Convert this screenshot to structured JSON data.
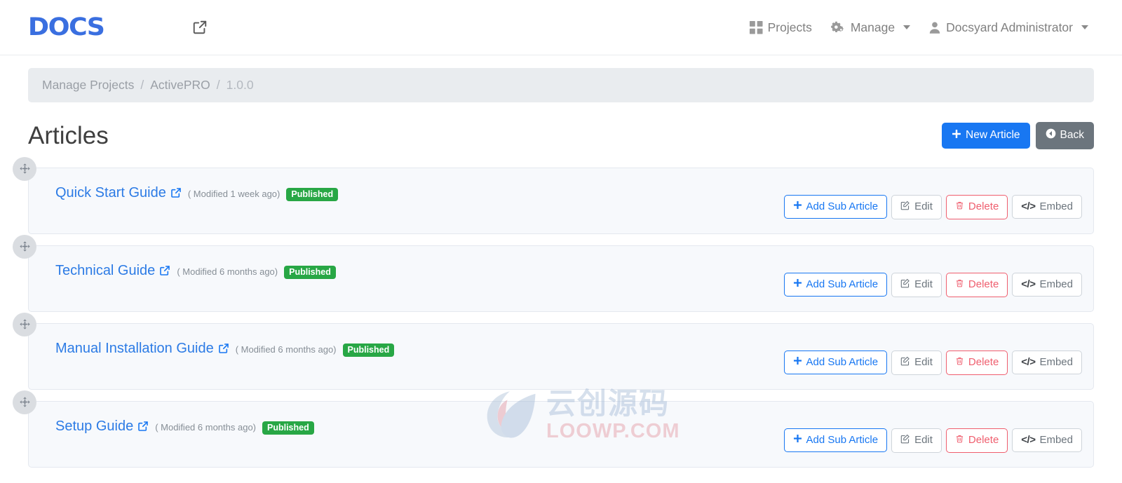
{
  "header": {
    "brand_text": "DOCS",
    "brand_color": "#3a6fe0",
    "external_link_icon": "external-link-icon",
    "nav": [
      {
        "label": "Projects",
        "icon": "grid-icon",
        "has_caret": false
      },
      {
        "label": "Manage",
        "icon": "gears-icon",
        "has_caret": true
      },
      {
        "label": "Docsyard Administrator",
        "icon": "user-icon",
        "has_caret": true
      }
    ]
  },
  "breadcrumb": {
    "items": [
      {
        "label": "Manage Projects",
        "current": false
      },
      {
        "label": "ActivePRO",
        "current": false
      },
      {
        "label": "1.0.0",
        "current": true
      }
    ],
    "separator": "/"
  },
  "page": {
    "title": "Articles",
    "actions": [
      {
        "label": "New Article",
        "icon": "plus-icon",
        "style": "primary",
        "color": "#1877f2"
      },
      {
        "label": "Back",
        "icon": "arrow-circle-left-icon",
        "style": "secondary",
        "color": "#6c757d"
      }
    ]
  },
  "row_actions": {
    "add_sub_article": {
      "label": "Add Sub Article",
      "icon": "plus-icon",
      "color": "#1877f2"
    },
    "edit": {
      "label": "Edit",
      "icon": "pencil-square-icon",
      "color": "#6c757d"
    },
    "delete": {
      "label": "Delete",
      "icon": "trash-icon",
      "color": "#ef5e6e"
    },
    "embed": {
      "label": "Embed",
      "icon": "code-icon",
      "color": "#6c757d"
    }
  },
  "articles": [
    {
      "title": "Quick Start Guide",
      "modified": "( Modified 1 week ago)",
      "status": "Published",
      "status_color": "#28a745",
      "link_icon": "external-link-icon",
      "drag_icon": "arrows-move-icon"
    },
    {
      "title": "Technical Guide",
      "modified": "( Modified 6 months ago)",
      "status": "Published",
      "status_color": "#28a745",
      "link_icon": "external-link-icon",
      "drag_icon": "arrows-move-icon"
    },
    {
      "title": "Manual Installation Guide",
      "modified": "( Modified 6 months ago)",
      "status": "Published",
      "status_color": "#28a745",
      "link_icon": "external-link-icon",
      "drag_icon": "arrows-move-icon"
    },
    {
      "title": "Setup Guide",
      "modified": "( Modified 6 months ago)",
      "status": "Published",
      "status_color": "#28a745",
      "link_icon": "external-link-icon",
      "drag_icon": "arrows-move-icon"
    }
  ],
  "watermark": {
    "cn_text": "云创源码",
    "en_text": "LOOWP.COM",
    "cn_color": "#9fb6d4",
    "en_color": "#e2919c"
  }
}
